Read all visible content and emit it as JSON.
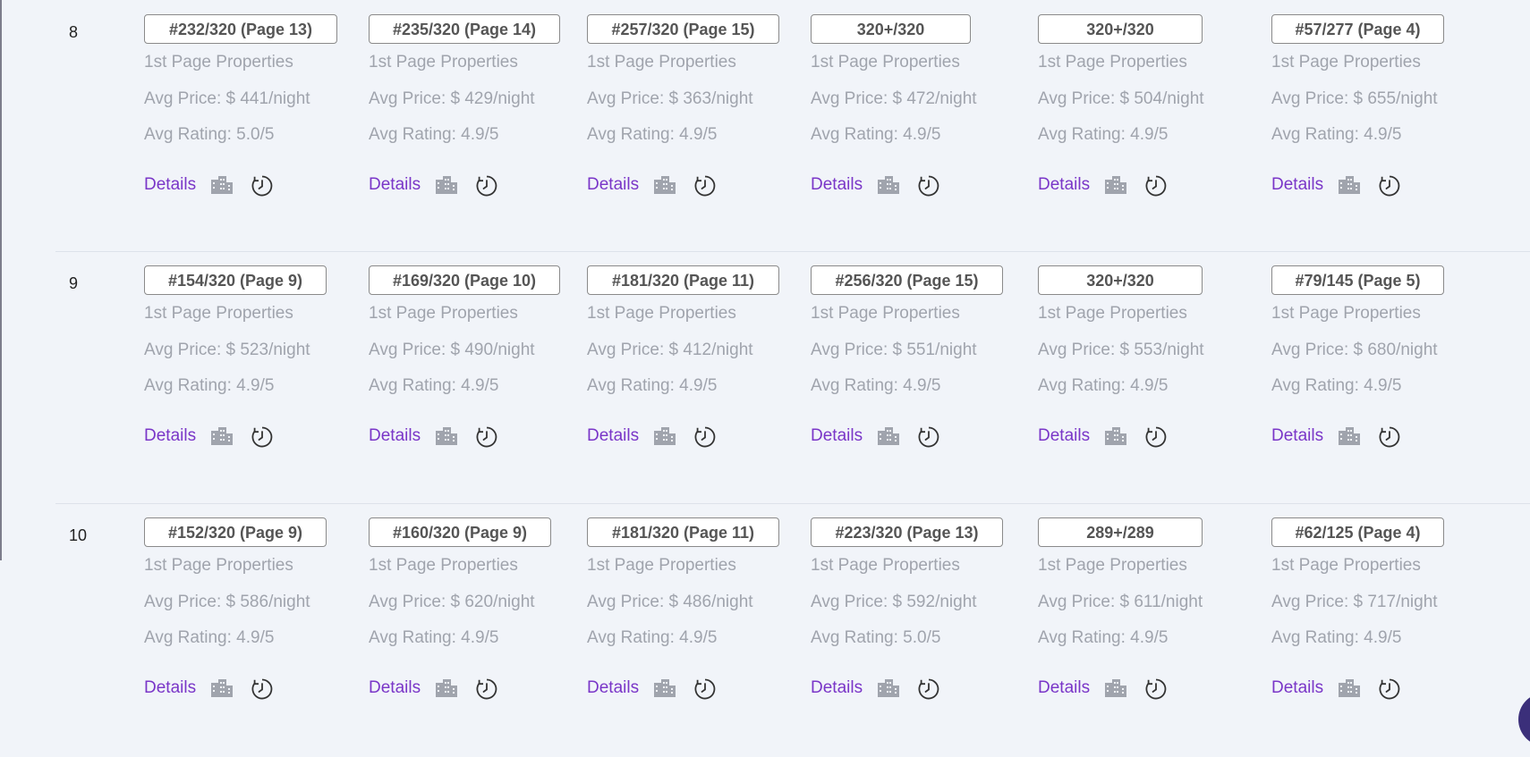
{
  "rows": [
    {
      "num": "8",
      "cells": [
        {
          "rank": "#232/320 (Page 13)",
          "props": "1st Page Properties",
          "price": "Avg Price: $ 441/night",
          "rating": "Avg Rating: 5.0/5",
          "details": "Details"
        },
        {
          "rank": "#235/320 (Page 14)",
          "props": "1st Page Properties",
          "price": "Avg Price: $ 429/night",
          "rating": "Avg Rating: 4.9/5",
          "details": "Details"
        },
        {
          "rank": "#257/320 (Page 15)",
          "props": "1st Page Properties",
          "price": "Avg Price: $ 363/night",
          "rating": "Avg Rating: 4.9/5",
          "details": "Details"
        },
        {
          "rank": "320+/320",
          "props": "1st Page Properties",
          "price": "Avg Price: $ 472/night",
          "rating": "Avg Rating: 4.9/5",
          "details": "Details"
        },
        {
          "rank": "320+/320",
          "props": "1st Page Properties",
          "price": "Avg Price: $ 504/night",
          "rating": "Avg Rating: 4.9/5",
          "details": "Details"
        },
        {
          "rank": "#57/277 (Page 4)",
          "props": "1st Page Properties",
          "price": "Avg Price: $ 655/night",
          "rating": "Avg Rating: 4.9/5",
          "details": "Details"
        }
      ]
    },
    {
      "num": "9",
      "cells": [
        {
          "rank": "#154/320 (Page 9)",
          "props": "1st Page Properties",
          "price": "Avg Price: $ 523/night",
          "rating": "Avg Rating: 4.9/5",
          "details": "Details"
        },
        {
          "rank": "#169/320 (Page 10)",
          "props": "1st Page Properties",
          "price": "Avg Price: $ 490/night",
          "rating": "Avg Rating: 4.9/5",
          "details": "Details"
        },
        {
          "rank": "#181/320 (Page 11)",
          "props": "1st Page Properties",
          "price": "Avg Price: $ 412/night",
          "rating": "Avg Rating: 4.9/5",
          "details": "Details"
        },
        {
          "rank": "#256/320 (Page 15)",
          "props": "1st Page Properties",
          "price": "Avg Price: $ 551/night",
          "rating": "Avg Rating: 4.9/5",
          "details": "Details"
        },
        {
          "rank": "320+/320",
          "props": "1st Page Properties",
          "price": "Avg Price: $ 553/night",
          "rating": "Avg Rating: 4.9/5",
          "details": "Details"
        },
        {
          "rank": "#79/145 (Page 5)",
          "props": "1st Page Properties",
          "price": "Avg Price: $ 680/night",
          "rating": "Avg Rating: 4.9/5",
          "details": "Details"
        }
      ]
    },
    {
      "num": "10",
      "cells": [
        {
          "rank": "#152/320 (Page 9)",
          "props": "1st Page Properties",
          "price": "Avg Price: $ 586/night",
          "rating": "Avg Rating: 4.9/5",
          "details": "Details"
        },
        {
          "rank": "#160/320 (Page 9)",
          "props": "1st Page Properties",
          "price": "Avg Price: $ 620/night",
          "rating": "Avg Rating: 4.9/5",
          "details": "Details"
        },
        {
          "rank": "#181/320 (Page 11)",
          "props": "1st Page Properties",
          "price": "Avg Price: $ 486/night",
          "rating": "Avg Rating: 4.9/5",
          "details": "Details"
        },
        {
          "rank": "#223/320 (Page 13)",
          "props": "1st Page Properties",
          "price": "Avg Price: $ 592/night",
          "rating": "Avg Rating: 5.0/5",
          "details": "Details"
        },
        {
          "rank": "289+/289",
          "props": "1st Page Properties",
          "price": "Avg Price: $ 611/night",
          "rating": "Avg Rating: 4.9/5",
          "details": "Details"
        },
        {
          "rank": "#62/125 (Page 4)",
          "props": "1st Page Properties",
          "price": "Avg Price: $ 717/night",
          "rating": "Avg Rating: 4.9/5",
          "details": "Details"
        }
      ]
    }
  ],
  "icons": {
    "building": "building-icon",
    "history": "history-icon",
    "chat": "chat-icon"
  },
  "colors": {
    "accent": "#7a36c8",
    "muted": "#a0a4ad",
    "background": "#f1f4f9",
    "chat": "#3b2f7a"
  }
}
